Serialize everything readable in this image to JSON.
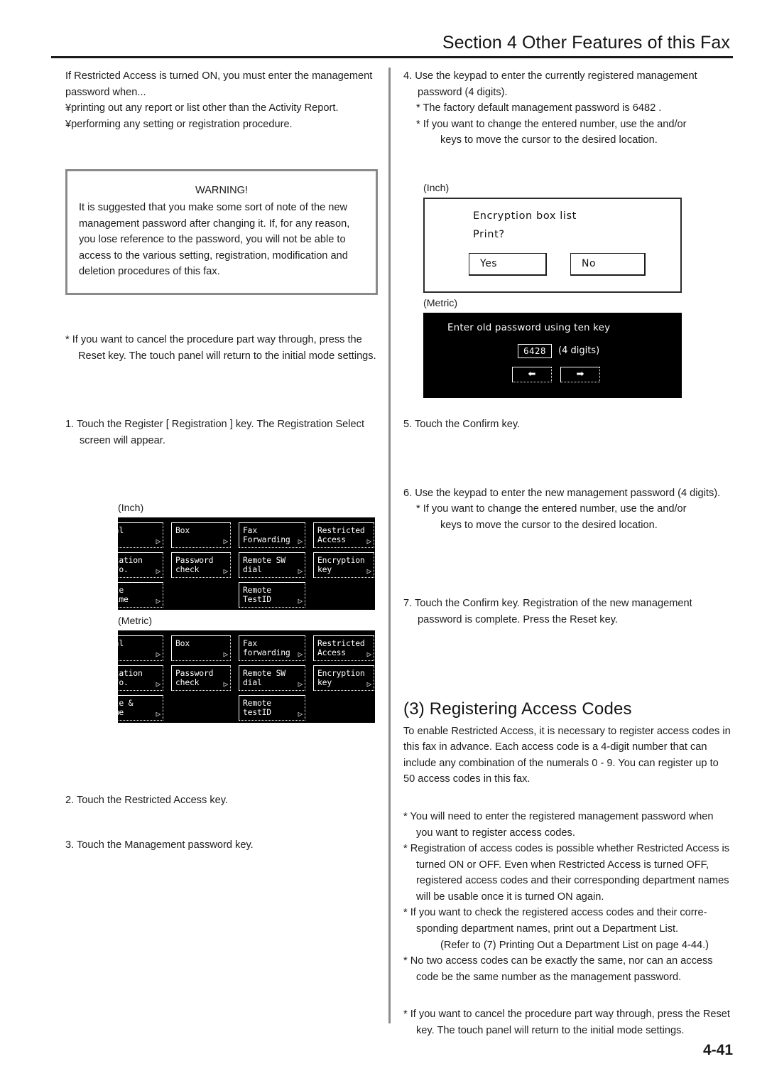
{
  "header": {
    "title": "Section 4 Other Features of this Fax"
  },
  "page_number": "4-41",
  "left_column": {
    "intro": "If Restricted Access is turned ON, you must enter the management password when...",
    "bullet_print": "¥printing out any report or list other than the Activity Report.",
    "bullet_perform": "¥performing any setting or registration procedure.",
    "warning": {
      "title": "WARNING!",
      "body": "It is suggested that you make some sort of note of the new management password after changing it. If, for any reason, you lose reference to the password, you will not be able to access to the various setting, registration, modification and deletion procedures of this fax."
    },
    "note_cancel": "* If you want to cancel the procedure part way through, press the Reset key. The touch panel will return to the initial mode settings.",
    "step1": "1. Touch the  Register  [ Registration ] key. The Registration Select screen will appear.",
    "fig_inch_caption": "(Inch)",
    "fig_metric_caption": "(Metric)",
    "step2": "2. Touch the  Restricted Access  key.",
    "step3": "3. Touch the  Management password  key."
  },
  "menu_inch": {
    "rows": [
      [
        {
          "label": "ial",
          "arrow": "▷"
        },
        {
          "label": "Box",
          "arrow": "▷"
        },
        {
          "label": "Fax\nForwarding",
          "arrow": "▷"
        },
        {
          "label": "Restricted\nAccess",
          "arrow": "▷"
        }
      ],
      [
        {
          "label": "ocation\nnfo.",
          "arrow": "▷"
        },
        {
          "label": "Password\ncheck",
          "arrow": "▷"
        },
        {
          "label": "Remote SW\ndial",
          "arrow": "▷"
        },
        {
          "label": "Encryption\nkey",
          "arrow": "▷"
        }
      ],
      [
        {
          "label": "ate\n Time",
          "arrow": "▷"
        },
        {
          "label": "",
          "arrow": ""
        },
        {
          "label": "Remote\nTestID",
          "arrow": "▷"
        },
        {
          "label": "",
          "arrow": ""
        }
      ]
    ]
  },
  "menu_metric": {
    "rows": [
      [
        {
          "label": "ial",
          "arrow": "▷"
        },
        {
          "label": "Box",
          "arrow": "▷"
        },
        {
          "label": "Fax\nforwarding",
          "arrow": "▷"
        },
        {
          "label": "Restricted\nAccess",
          "arrow": "▷"
        }
      ],
      [
        {
          "label": "ocation\nnfo.",
          "arrow": "▷"
        },
        {
          "label": "Password\ncheck",
          "arrow": "▷"
        },
        {
          "label": "Remote SW\ndial",
          "arrow": "▷"
        },
        {
          "label": "Encryption\nkey",
          "arrow": "▷"
        }
      ],
      [
        {
          "label": "ate &\nime",
          "arrow": "▷"
        },
        {
          "label": "",
          "arrow": ""
        },
        {
          "label": "Remote\ntestID",
          "arrow": "▷"
        },
        {
          "label": "",
          "arrow": ""
        }
      ]
    ]
  },
  "right_column": {
    "step4": "4. Use the keypad to enter the currently registered management password (4 digits).",
    "step4_note1": "* The factory default management password is  6482 .",
    "step4_note2": "* If you want to change the entered number, use the          and/or",
    "step4_note3": "keys to move the cursor to the desired location.",
    "fig_inch_caption": "(Inch)",
    "fig_metric_caption": "(Metric)",
    "step5": "5. Touch the  Confirm  key.",
    "step6": "6. Use the keypad to enter the new management password (4 digits).",
    "step6_note1": "* If you want to change the entered number, use the          and/or",
    "step6_note2": "keys to move the cursor to the desired location.",
    "step7": "7. Touch the  Confirm  key. Registration of the new management password is complete. Press the Reset key.",
    "section_heading": "(3) Registering Access Codes",
    "section_body": "To enable Restricted Access, it is necessary to register access codes in this fax in advance. Each access code is a 4-digit number that can include any combination of the numerals 0 - 9. You can register up to 50 access codes in this fax.",
    "note1": "* You will need to enter the registered management password when you want to register access codes.",
    "note2": "* Registration of access codes is possible whether Restricted Access is turned ON or OFF. Even when Restricted Access is turned OFF, registered access codes and their corresponding department names will be usable once it is turned ON again.",
    "note3": "* If you want to check the registered access codes and their corre-sponding department names, print out a Department List.",
    "note3b": "(Refer to  (7) Printing Out a Department List  on page 4-44.)",
    "note4": "* No two access codes can be exactly the same, nor can an access code be the same number as the management password.",
    "note5": "* If you want to cancel the procedure part way through, press the Reset key. The touch panel will return to the initial mode settings."
  },
  "dialog_inch": {
    "line1": "Encryption box list",
    "line2": "Print?",
    "yes_label": "Yes",
    "no_label": "No"
  },
  "dialog_metric": {
    "prompt": "Enter old password using ten key",
    "value": "6428",
    "digits_hint": "(4 digits)",
    "arrow_left": "⬅",
    "arrow_right": "➡"
  }
}
